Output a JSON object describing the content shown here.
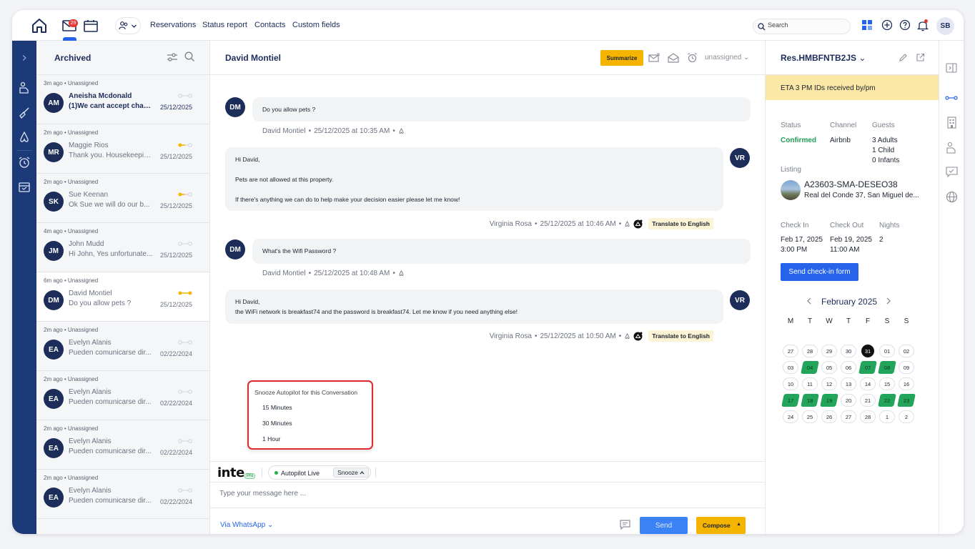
{
  "topbar": {
    "mail_badge": "29",
    "nav_links": [
      "Reservations",
      "Status report",
      "Contacts",
      "Custom fields"
    ],
    "search_placeholder": "Search",
    "user_initials": "SB"
  },
  "conversation_list": {
    "title": "Archived",
    "items": [
      {
        "meta": "3m ago • Unassigned",
        "initials": "AM",
        "name": "Aneisha Mcdonald",
        "preview": "(1)We cant accept chan...",
        "date": "25/12/2025",
        "unread": true,
        "status": "none"
      },
      {
        "meta": "2m ago • Unassigned",
        "initials": "MR",
        "name": "Maggie Rios",
        "preview": "Thank you. Housekeepin...",
        "date": "25/12/2025",
        "unread": false,
        "status": "half"
      },
      {
        "meta": "2m ago • Unassigned",
        "initials": "SK",
        "name": "Sue Keenan",
        "preview": "Ok Sue we will do our b...",
        "date": "25/12/2025",
        "unread": false,
        "status": "half"
      },
      {
        "meta": "4m ago • Unassigned",
        "initials": "JM",
        "name": "John Mudd",
        "preview": "Hi John, Yes unfortunate...",
        "date": "25/12/2025",
        "unread": false,
        "status": "none"
      },
      {
        "meta": "6m ago • Unassigned",
        "initials": "DM",
        "name": "David Montiel",
        "preview": "Do you allow pets ?",
        "date": "25/12/2025",
        "unread": false,
        "status": "full",
        "active": true
      },
      {
        "meta": "2m ago • Unassigned",
        "initials": "EA",
        "name": "Evelyn Alanis",
        "preview": "Pueden comunicarse dir...",
        "date": "02/22/2024",
        "unread": false,
        "status": "none"
      },
      {
        "meta": "2m ago • Unassigned",
        "initials": "EA",
        "name": "Evelyn Alanis",
        "preview": "Pueden comunicarse dir...",
        "date": "02/22/2024",
        "unread": false,
        "status": "none"
      },
      {
        "meta": "2m ago • Unassigned",
        "initials": "EA",
        "name": "Evelyn Alanis",
        "preview": "Pueden comunicarse dir...",
        "date": "02/22/2024",
        "unread": false,
        "status": "none"
      },
      {
        "meta": "2m ago • Unassigned",
        "initials": "EA",
        "name": "Evelyn Alanis",
        "preview": "Pueden comunicarse dir...",
        "date": "02/22/2024",
        "unread": false,
        "status": "none"
      }
    ]
  },
  "chat": {
    "title": "David Montiel",
    "summarize_label": "Summarize",
    "assignee": "unassigned",
    "messages": [
      {
        "initials": "DM",
        "side": "left",
        "lines": [
          "Do you allow pets ?"
        ],
        "author": "David Montiel",
        "time": "25/12/2025  at 10:35 AM"
      },
      {
        "initials": "VR",
        "side": "right",
        "lines": [
          "Hi David,",
          "",
          "Pets are not allowed at this property.",
          "",
          "If there's anything we can do to help make your decision easier please let me know!"
        ],
        "author": "Virginia Rosa",
        "time": "25/12/2025  at 10:46 AM",
        "translate": "Translate to English"
      },
      {
        "initials": "DM",
        "side": "left",
        "lines": [
          "What's the Wifi Password ?"
        ],
        "author": "David Montiel",
        "time": "25/12/2025  at 10:48 AM"
      },
      {
        "initials": "VR",
        "side": "right",
        "lines": [
          "Hi David,",
          "the WiFi network is breakfast74 and the password is breakfast74. Let me know if you need anything else!"
        ],
        "author": "Virginia Rosa",
        "time": "25/12/2025  at 10:50 AM",
        "translate": "Translate to English"
      }
    ],
    "snooze_menu": {
      "title": "Snooze Autopilot for this Conversation",
      "options": [
        "15 Minutes",
        "30 Minutes",
        "1 Hour"
      ]
    },
    "logo_text": "inte",
    "pro_label": "Pro",
    "autopilot_label": "Autopilot Live",
    "snooze_label": "Snooze",
    "input_placeholder": "Type your message here ...",
    "channel_label": "Via WhatsApp",
    "send_label": "Send",
    "compose_label": "Compose"
  },
  "reservation": {
    "title": "Res.HMBFNTB2JS",
    "eta_banner": "ETA 3 PM IDs received by/pm",
    "status_label": "Status",
    "status_value": "Confirmed",
    "channel_label": "Channel",
    "channel_value": "Airbnb",
    "guests_label": "Guests",
    "guests_values": [
      "3 Adults",
      "1 Child",
      "0 Infants"
    ],
    "listing_label": "Listing",
    "listing_name": "A23603-SMA-DESEO38",
    "listing_address": "Real del Conde 37, San Miguel de...",
    "checkin_label": "Check In",
    "checkin_date": "Feb 17, 2025",
    "checkin_time": "3:00 PM",
    "checkout_label": "Check Out",
    "checkout_date": "Feb 19, 2025",
    "checkout_time": "11:00 AM",
    "nights_label": "Nights",
    "nights_value": "2",
    "checkin_form_button": "Send check-in form",
    "calendar": {
      "month": "February 2025",
      "weekdays": [
        "M",
        "T",
        "W",
        "T",
        "F",
        "S",
        "S"
      ],
      "weeks": [
        [
          "27",
          "28",
          "29",
          "30",
          "31",
          "01",
          "02"
        ],
        [
          "03",
          "04",
          "05",
          "06",
          "07",
          "08",
          "09"
        ],
        [
          "10",
          "11",
          "12",
          "13",
          "14",
          "15",
          "16"
        ],
        [
          "17",
          "18",
          "19",
          "20",
          "21",
          "22",
          "23"
        ],
        [
          "24",
          "25",
          "26",
          "27",
          "28",
          "1",
          "2"
        ]
      ],
      "today": "31",
      "booked": [
        "04",
        "07",
        "08",
        "17",
        "18",
        "19",
        "22",
        "23"
      ]
    }
  },
  "colors": {
    "brand_navy": "#1d3a78",
    "accent_yellow": "#f5b400",
    "primary_blue": "#2563eb",
    "booked_green": "#22a55a",
    "highlight_red": "#e0282e"
  }
}
